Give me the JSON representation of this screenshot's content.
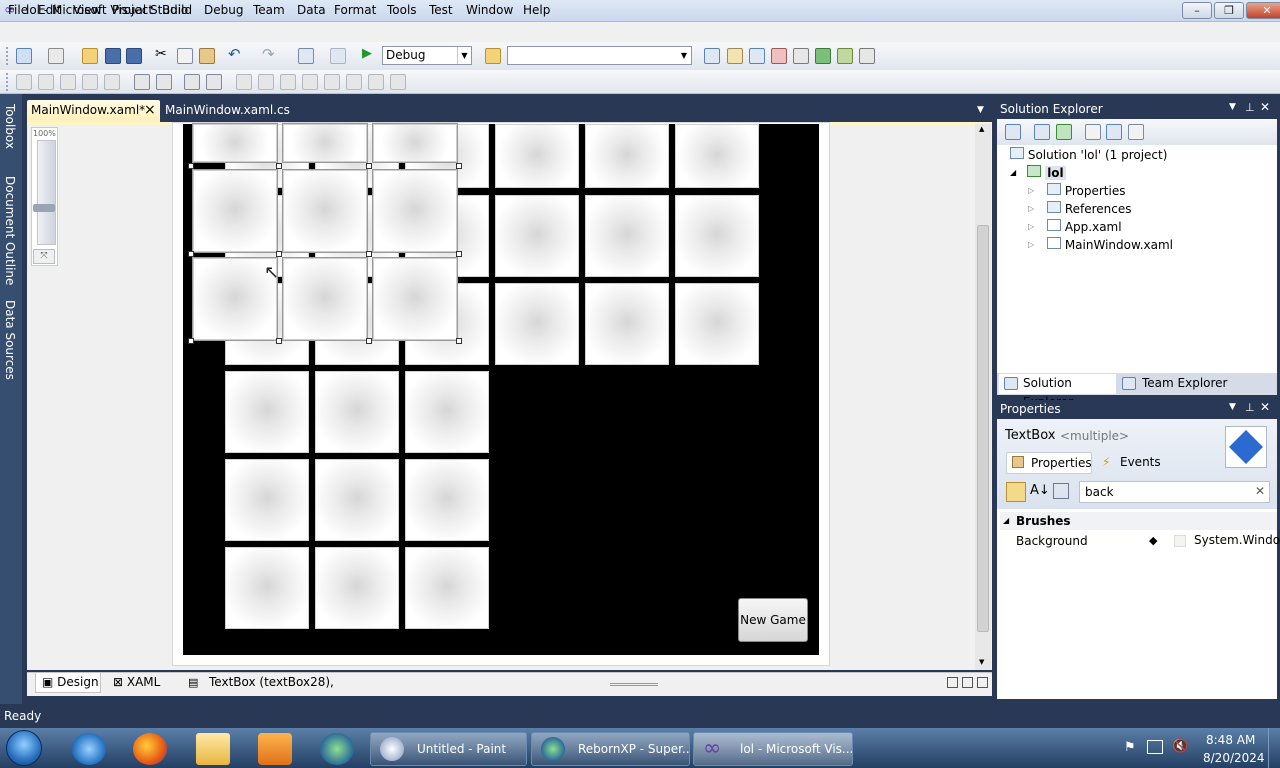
{
  "window": {
    "title": "lol - Microsoft Visual Studio",
    "minimize": "–",
    "maximize": "❐",
    "close": "✕"
  },
  "menu": [
    "File",
    "Edit",
    "View",
    "Project",
    "Build",
    "Debug",
    "Team",
    "Data",
    "Format",
    "Tools",
    "Test",
    "Window",
    "Help"
  ],
  "toolbar": {
    "configuration": "Debug",
    "platform": ""
  },
  "side_tabs": [
    "Toolbox",
    "Document Outline",
    "Data Sources"
  ],
  "doc_tabs": {
    "active": "MainWindow.xaml*",
    "other": "MainWindow.xaml.cs",
    "close": "×"
  },
  "designer": {
    "zoom": "100%",
    "new_game_button": "New Game",
    "tiles": {
      "columns": 6,
      "rows": 6
    }
  },
  "bottom": {
    "design_tab": "Design",
    "xaml_tab": "XAML",
    "breadcrumb": "TextBox (textBox28),"
  },
  "solution_explorer": {
    "title": "Solution Explorer",
    "solution": "Solution 'lol' (1 project)",
    "project": "lol",
    "items": [
      "Properties",
      "References",
      "App.xaml",
      "MainWindow.xaml"
    ],
    "tab_solution": "Solution Explorer",
    "tab_team": "Team Explorer"
  },
  "properties": {
    "title": "Properties",
    "object_type": "TextBox",
    "object_name": "<multiple>",
    "tab_properties": "Properties",
    "tab_events": "Events",
    "search_value": "back",
    "category": "Brushes",
    "property_name": "Background",
    "property_value": "System.Windo"
  },
  "status": {
    "text": "Ready"
  },
  "taskbar": {
    "apps": [
      "Untitled - Paint",
      "RebornXP - Super...",
      "lol - Microsoft Vis..."
    ],
    "time": "8:48 AM",
    "date": "8/20/2024"
  }
}
